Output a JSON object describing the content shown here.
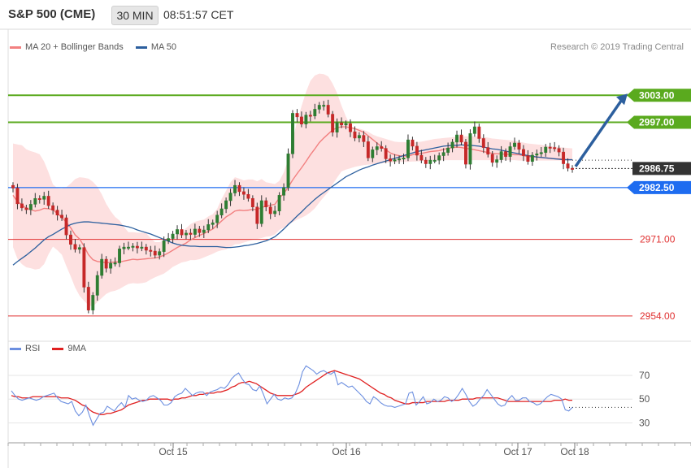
{
  "header": {
    "title": "S&P 500 (CME)",
    "interval": "30 MIN",
    "time": "08:51:57 CET"
  },
  "legend_main": {
    "ma20_label": "MA 20 + Bollinger Bands",
    "ma50_label": "MA 50"
  },
  "legend_rsi": {
    "rsi_label": "RSI",
    "ma9_label": "9MA"
  },
  "copyright": "Research © 2019 Trading Central",
  "colors": {
    "bull": "#2e7d32",
    "bear": "#c62828",
    "ma20": "#f28080",
    "ma50": "#2c5f9e",
    "band": "#fde0e0",
    "resistance": "#5aaa1e",
    "support": "#e03030",
    "pivot": "#1e6cf0",
    "current": "#333333",
    "arrow": "#2c5f9e",
    "rsi": "#6c8fe0",
    "ma9": "#e02020"
  },
  "chart_data": [
    {
      "type": "candlestick",
      "ylim": [
        2952,
        3009
      ],
      "x_labels": [
        "Oct 15",
        "Oct 16",
        "Oct 17",
        "Oct 18"
      ],
      "levels": [
        {
          "kind": "resistance",
          "value": 3003.0,
          "label": "3003.00"
        },
        {
          "kind": "resistance",
          "value": 2997.0,
          "label": "2997.00"
        },
        {
          "kind": "current",
          "value": 2986.75,
          "label": "2986.75"
        },
        {
          "kind": "pivot",
          "value": 2982.5,
          "label": "2982.50"
        },
        {
          "kind": "support",
          "value": 2971.0,
          "label": "2971.00"
        },
        {
          "kind": "support",
          "value": 2954.0,
          "label": "2954.00"
        }
      ],
      "dotted_line": 2988.6,
      "closes": [
        2982.4,
        2978.9,
        2978.0,
        2977.6,
        2978.8,
        2980.1,
        2979.9,
        2980.6,
        2978.5,
        2977.5,
        2976.4,
        2975.8,
        2972.0,
        2969.9,
        2968.8,
        2969.2,
        2960.4,
        2955.3,
        2958.6,
        2963.0,
        2966.6,
        2964.6,
        2965.7,
        2965.8,
        2968.9,
        2969.3,
        2969.3,
        2969.5,
        2969.1,
        2969.3,
        2968.6,
        2968.4,
        2967.5,
        2968.3,
        2970.7,
        2971.2,
        2972.2,
        2973.2,
        2972.0,
        2972.4,
        2972.1,
        2973.3,
        2972.5,
        2973.1,
        2974.3,
        2974.7,
        2976.4,
        2977.8,
        2979.6,
        2981.3,
        2983.0,
        2981.6,
        2981.0,
        2980.1,
        2978.2,
        2974.5,
        2979.6,
        2978.2,
        2976.7,
        2977.3,
        2980.8,
        2982.5,
        2990.0,
        2999.0,
        2998.2,
        2996.6,
        2998.6,
        2998.4,
        2999.9,
        3000.8,
        3000.8,
        2998.8,
        2994.8,
        2996.9,
        2996.4,
        2996.7,
        2994.9,
        2993.5,
        2994.1,
        2992.7,
        2989.1,
        2990.9,
        2991.6,
        2991.2,
        2988.9,
        2988.4,
        2988.7,
        2988.9,
        2989.1,
        2993.1,
        2991.7,
        2989.7,
        2988.6,
        2987.8,
        2988.6,
        2988.6,
        2989.6,
        2990.3,
        2991.3,
        2992.6,
        2994.2,
        2992.6,
        2987.7,
        2994.5,
        2996.0,
        2993.4,
        2991.4,
        2989.9,
        2988.1,
        2988.7,
        2990.5,
        2989.4,
        2991.6,
        2992.4,
        2991.0,
        2989.6,
        2988.3,
        2989.7,
        2990.0,
        2990.3,
        2991.5,
        2991.4,
        2991.2,
        2990.4,
        2987.8,
        2986.8,
        2986.75
      ],
      "ma20": [
        2980.8,
        2979.4,
        2978.7,
        2977.9,
        2977.6,
        2977.3,
        2977.5,
        2977.9,
        2977.8,
        2977.6,
        2976.7,
        2975.9,
        2974.8,
        2973.6,
        2972.0,
        2971.1,
        2969.5,
        2967.6,
        2966.5,
        2966.1,
        2966.0,
        2965.8,
        2965.9,
        2966.0,
        2966.0,
        2966.2,
        2966.4,
        2966.6,
        2966.5,
        2966.6,
        2966.7,
        2966.8,
        2966.9,
        2967.1,
        2967.5,
        2968.0,
        2968.6,
        2969.2,
        2969.7,
        2970.2,
        2970.9,
        2971.4,
        2971.9,
        2972.3,
        2972.8,
        2973.3,
        2974.2,
        2975.1,
        2976.0,
        2976.6,
        2977.3,
        2977.5,
        2977.4,
        2977.5,
        2977.7,
        2977.6,
        2978.1,
        2978.4,
        2978.6,
        2978.8,
        2980.2,
        2981.2,
        2982.6,
        2984.2,
        2985.6,
        2986.9,
        2988.3,
        2989.8,
        2991.1,
        2992.5,
        2993.5,
        2994.4,
        2995.3,
        2995.8,
        2996.0,
        2996.0,
        2995.8,
        2995.6,
        2995.2,
        2994.8,
        2994.0,
        2993.2,
        2992.4,
        2991.6,
        2990.9,
        2990.2,
        2989.8,
        2989.6,
        2989.5,
        2989.5,
        2989.8,
        2990.0,
        2990.1,
        2990.3,
        2990.5,
        2990.6,
        2990.7,
        2991.0,
        2991.2,
        2991.4,
        2991.5,
        2991.4,
        2991.2,
        2991.1,
        2990.9,
        2990.7,
        2990.5,
        2990.3,
        2990.1,
        2990.0,
        2990.0,
        2989.9,
        2989.9,
        2989.8,
        2989.8,
        2989.6,
        2989.4,
        2989.3,
        2989.3,
        2989.2,
        2989.1,
        2989.0,
        2988.9,
        2988.9,
        2988.8,
        2988.7,
        2988.7
      ],
      "ma50": [
        2965.3,
        2966.1,
        2966.8,
        2967.5,
        2968.3,
        2969.1,
        2970.0,
        2970.9,
        2971.6,
        2972.1,
        2972.7,
        2973.3,
        2973.8,
        2974.3,
        2974.6,
        2974.8,
        2974.9,
        2974.9,
        2974.8,
        2974.7,
        2974.6,
        2974.5,
        2974.4,
        2974.3,
        2974.2,
        2974.0,
        2973.8,
        2973.5,
        2973.1,
        2972.8,
        2972.5,
        2972.2,
        2971.8,
        2971.4,
        2971.0,
        2970.6,
        2970.2,
        2969.9,
        2969.7,
        2969.6,
        2969.5,
        2969.5,
        2969.4,
        2969.4,
        2969.4,
        2969.4,
        2969.4,
        2969.3,
        2969.2,
        2969.2,
        2969.3,
        2969.4,
        2969.6,
        2969.7,
        2969.9,
        2970.1,
        2970.4,
        2970.7,
        2971.1,
        2971.6,
        2972.4,
        2973.3,
        2974.3,
        2975.2,
        2976.2,
        2977.1,
        2978.1,
        2979.0,
        2979.9,
        2980.7,
        2981.4,
        2982.1,
        2982.8,
        2983.5,
        2984.2,
        2984.9,
        2985.4,
        2985.9,
        2986.4,
        2986.8,
        2987.1,
        2987.5,
        2987.8,
        2988.1,
        2988.4,
        2988.7,
        2989.0,
        2989.3,
        2989.6,
        2989.9,
        2990.2,
        2990.5,
        2990.7,
        2990.9,
        2991.1,
        2991.3,
        2991.5,
        2991.7,
        2991.8,
        2991.9,
        2991.9,
        2992.0,
        2991.9,
        2991.9,
        2991.8,
        2991.7,
        2991.5,
        2991.3,
        2991.1,
        2991.0,
        2990.8,
        2990.6,
        2990.4,
        2990.2,
        2990.0,
        2989.8,
        2989.6,
        2989.5,
        2989.3,
        2989.2,
        2989.1,
        2989.0,
        2988.9,
        2988.8,
        2988.7,
        2988.7,
        2988.7
      ],
      "bb_upper": [
        2992.3,
        2992.1,
        2991.9,
        2991.0,
        2990.6,
        2990.3,
        2989.9,
        2988.3,
        2985.9,
        2983.2,
        2982.4,
        2982.3,
        2982.6,
        2983.4,
        2984.4,
        2984.8,
        2984.7,
        2984.5,
        2983.8,
        2982.7,
        2981.0,
        2978.9,
        2977.3,
        2976.0,
        2975.2,
        2973.8,
        2972.6,
        2972.6,
        2972.5,
        2972.5,
        2972.4,
        2971.3,
        2970.4,
        2970.4,
        2970.8,
        2970.6,
        2971.2,
        2972.1,
        2972.6,
        2973.5,
        2974.4,
        2974.9,
        2975.2,
        2975.4,
        2976.1,
        2976.6,
        2977.8,
        2980.0,
        2981.8,
        2983.7,
        2984.8,
        2984.5,
        2984.1,
        2984.3,
        2984.3,
        2983.9,
        2984.4,
        2983.7,
        2983.5,
        2983.3,
        2984.0,
        2985.9,
        2988.7,
        2993.1,
        2997.2,
        3000.6,
        3003.7,
        3006.2,
        3007.4,
        3007.8,
        3007.7,
        3007.2,
        3005.6,
        3003.5,
        3000.7,
        2998.3,
        2996.2,
        2995.7,
        2995.6,
        2995.3,
        2994.9,
        2994.3,
        2993.9,
        2993.6,
        2993.3,
        2993.0,
        2992.7,
        2992.6,
        2992.6,
        2992.5,
        2992.5,
        2992.6,
        2992.7,
        2992.9,
        2993.1,
        2993.3,
        2993.4,
        2993.5,
        2993.6,
        2993.7,
        2993.8,
        2993.9,
        2993.9,
        2993.9,
        2993.9,
        2993.8,
        2993.7,
        2993.6,
        2993.4,
        2993.3,
        2993.2,
        2993.1,
        2993.0,
        2992.9,
        2992.7,
        2992.5,
        2992.3,
        2992.2,
        2992.1,
        2992.0,
        2991.8,
        2991.7,
        2991.6,
        2991.5,
        2991.4,
        2991.3,
        2991.2
      ],
      "bb_lower": [
        2969.3,
        2966.7,
        2965.5,
        2964.8,
        2964.6,
        2964.3,
        2964.5,
        2965.5,
        2967.7,
        2969.4,
        2968.6,
        2967.6,
        2965.1,
        2962.8,
        2960.3,
        2958.5,
        2957.4,
        2956.4,
        2956.1,
        2957.1,
        2958.0,
        2958.9,
        2959.4,
        2959.6,
        2960.0,
        2960.6,
        2961.1,
        2961.3,
        2961.2,
        2961.3,
        2961.5,
        2962.1,
        2962.6,
        2963.0,
        2963.4,
        2964.1,
        2964.9,
        2965.4,
        2965.9,
        2966.1,
        2966.4,
        2966.4,
        2966.6,
        2967.0,
        2967.4,
        2967.8,
        2968.3,
        2968.6,
        2968.8,
        2969.3,
        2969.9,
        2970.0,
        2970.3,
        2970.6,
        2970.9,
        2971.1,
        2971.3,
        2971.6,
        2971.7,
        2972.1,
        2973.1,
        2973.6,
        2974.3,
        2974.8,
        2975.4,
        2975.8,
        2976.3,
        2977.0,
        2977.9,
        2979.2,
        2980.4,
        2981.5,
        2983.2,
        2984.7,
        2986.1,
        2986.5,
        2986.8,
        2987.1,
        2987.3,
        2987.5,
        2987.6,
        2987.7,
        2987.8,
        2987.9,
        2988.0,
        2988.1,
        2988.1,
        2988.2,
        2988.2,
        2988.2,
        2988.3,
        2988.3,
        2988.4,
        2988.4,
        2988.5,
        2988.5,
        2988.5,
        2988.6,
        2988.6,
        2988.6,
        2988.6,
        2988.6,
        2988.6,
        2988.6,
        2988.6,
        2988.6,
        2988.6,
        2988.6,
        2988.6,
        2988.6,
        2988.6,
        2988.6,
        2988.6,
        2988.6,
        2988.5,
        2988.5,
        2988.5,
        2988.5,
        2988.5,
        2988.5,
        2988.5,
        2988.5,
        2988.5,
        2988.5,
        2988.5,
        2988.5,
        2988.5
      ],
      "projection": {
        "from": 2987.2,
        "to": 3003.0
      }
    },
    {
      "type": "line",
      "name": "RSI",
      "ylim": [
        18,
        85
      ],
      "ticks": [
        70,
        50,
        30
      ],
      "dotted_line": 43,
      "rsi": [
        57,
        53,
        50,
        49,
        50,
        51,
        50,
        49,
        50,
        52,
        53,
        54,
        55,
        51,
        48,
        47,
        46,
        48,
        40,
        36,
        39,
        45,
        36,
        28,
        33,
        38,
        39,
        44,
        42,
        40,
        44,
        47,
        43,
        53,
        50,
        51,
        49,
        48,
        49,
        52,
        53,
        51,
        49,
        45,
        45,
        47,
        52,
        54,
        55,
        59,
        56,
        53,
        55,
        56,
        56,
        53,
        56,
        57,
        58,
        60,
        59,
        62,
        67,
        70,
        72,
        67,
        63,
        62,
        58,
        57,
        61,
        54,
        46,
        50,
        54,
        50,
        49,
        51,
        50,
        51,
        55,
        62,
        73,
        78,
        76,
        74,
        71,
        73,
        74,
        72,
        71,
        73,
        62,
        64,
        62,
        60,
        61,
        58,
        55,
        52,
        48,
        46,
        52,
        50,
        47,
        45,
        44,
        44,
        43,
        44,
        45,
        46,
        55,
        56,
        45,
        48,
        52,
        46,
        47,
        50,
        48,
        49,
        52,
        51,
        48,
        50,
        54,
        59,
        54,
        48,
        44,
        46,
        50,
        53,
        58,
        54,
        50,
        46,
        44,
        45,
        50,
        53,
        49,
        49,
        51,
        51,
        48,
        47,
        45,
        46,
        49,
        52,
        54,
        53,
        52,
        50,
        41,
        40,
        43
      ],
      "ma9": [
        53,
        52,
        52,
        51,
        51,
        51,
        52,
        52,
        52,
        52,
        52,
        52,
        52,
        52,
        51,
        51,
        51,
        50,
        49,
        47,
        45,
        44,
        41,
        39,
        38,
        37,
        37,
        38,
        38,
        39,
        40,
        41,
        43,
        45,
        46,
        47,
        48,
        49,
        49,
        50,
        50,
        50,
        50,
        50,
        50,
        49,
        50,
        50,
        51,
        51,
        52,
        53,
        53,
        54,
        54,
        55,
        55,
        55,
        56,
        56,
        57,
        58,
        60,
        61,
        63,
        64,
        64,
        65,
        64,
        63,
        61,
        59,
        57,
        55,
        54,
        53,
        53,
        53,
        53,
        53,
        54,
        55,
        57,
        60,
        62,
        64,
        66,
        68,
        70,
        72,
        73,
        74,
        73,
        72,
        71,
        70,
        69,
        68,
        67,
        65,
        63,
        61,
        59,
        57,
        55,
        54,
        52,
        51,
        49,
        48,
        47,
        46,
        46,
        47,
        47,
        47,
        47,
        48,
        48,
        48,
        48,
        48,
        48,
        49,
        49,
        49,
        49,
        50,
        50,
        50,
        50,
        51,
        51,
        51,
        51,
        51,
        51,
        51,
        50,
        49,
        48,
        48,
        48,
        48,
        48,
        48,
        48,
        48,
        48,
        48,
        48,
        48,
        48,
        49,
        49,
        49,
        50,
        49,
        49
      ],
      "x_labels": [
        "Oct 15",
        "Oct 16",
        "Oct 17",
        "Oct 18"
      ]
    }
  ]
}
